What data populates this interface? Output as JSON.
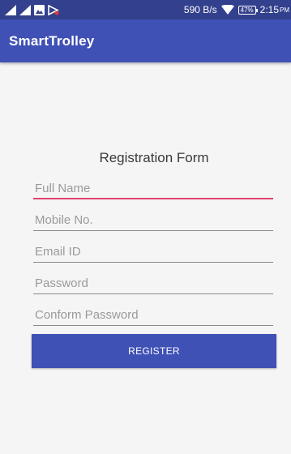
{
  "status_bar": {
    "left_icons": [
      "signal-icon",
      "signal-icon",
      "image-notification-icon",
      "no-sim-icon"
    ],
    "network_speed": "590 B/s",
    "wifi_icon": "wifi-icon",
    "battery_level": "47%",
    "time": "2:15",
    "ampm": "PM"
  },
  "app_bar": {
    "title": "SmartTrolley"
  },
  "form": {
    "title": "Registration Form",
    "fields": [
      {
        "placeholder": "Full Name",
        "value": ""
      },
      {
        "placeholder": "Mobile No.",
        "value": ""
      },
      {
        "placeholder": "Email ID",
        "value": ""
      },
      {
        "placeholder": "Password",
        "value": ""
      },
      {
        "placeholder": "Conform Password",
        "value": ""
      }
    ],
    "register_label": "REGISTER"
  },
  "colors": {
    "primary": "#3f51b5",
    "primary_dark": "#33408d",
    "accent": "#e0456e"
  }
}
